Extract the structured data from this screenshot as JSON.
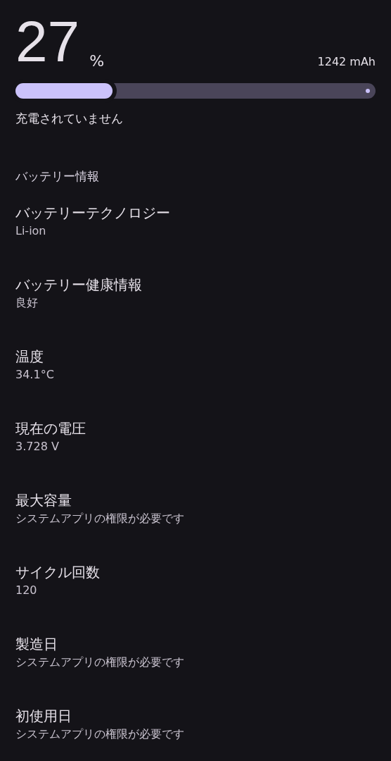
{
  "battery": {
    "percent": "27",
    "unit": "%",
    "capacity": "1242 mAh",
    "level": 0.27,
    "status": "充電されていません"
  },
  "section": {
    "title": "バッテリー情報"
  },
  "items": [
    {
      "title": "バッテリーテクノロジー",
      "value": "Li-ion"
    },
    {
      "title": "バッテリー健康情報",
      "value": "良好"
    },
    {
      "title": "温度",
      "value": "34.1°C"
    },
    {
      "title": "現在の電圧",
      "value": "3.728 V"
    },
    {
      "title": "最大容量",
      "value": "システムアプリの権限が必要です"
    },
    {
      "title": "サイクル回数",
      "value": "120"
    },
    {
      "title": "製造日",
      "value": "システムアプリの権限が必要です"
    },
    {
      "title": "初使用日",
      "value": "システムアプリの権限が必要です"
    }
  ]
}
